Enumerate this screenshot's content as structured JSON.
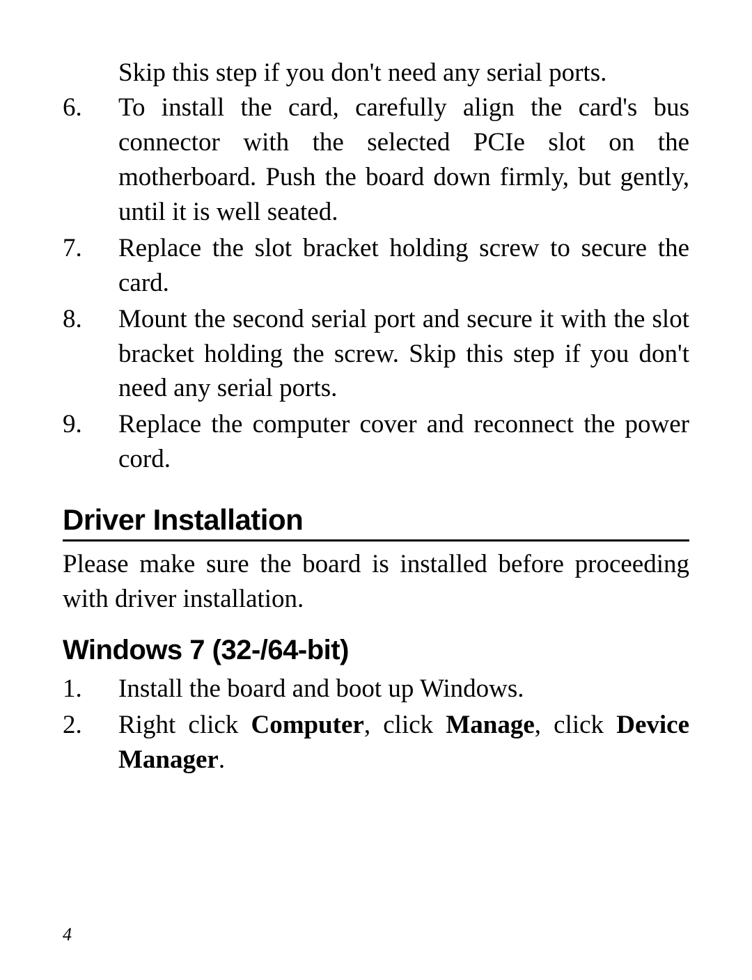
{
  "top_steps": {
    "continuation": "Skip this step if you don't need any serial ports.",
    "items": [
      {
        "num": "6.",
        "text": "To install the card, carefully align the card's bus connector with the selected PCIe slot on the motherboard.  Push the board down firmly, but gently, until it is well seated."
      },
      {
        "num": "7.",
        "text": "Replace the slot bracket holding screw to secure the card."
      },
      {
        "num": "8.",
        "text": "Mount the second serial port and secure it with the slot bracket holding the screw. Skip this step if you don't need any serial ports."
      },
      {
        "num": "9.",
        "text": "Replace the computer cover and reconnect the power cord."
      }
    ]
  },
  "section": {
    "heading": "Driver Installation",
    "intro": "Please make sure the board is installed before proceeding with driver installation.",
    "subheading": "Windows 7 (32-/64-bit)",
    "steps": [
      {
        "num": "1.",
        "text": "Install the board and boot up Windows."
      },
      {
        "num": "2.",
        "parts": {
          "a": "Right click ",
          "b": "Computer",
          "c": ", click ",
          "d": "Manage",
          "e": ", click ",
          "f": "Device Manager",
          "g": "."
        }
      }
    ]
  },
  "page_number": "4"
}
